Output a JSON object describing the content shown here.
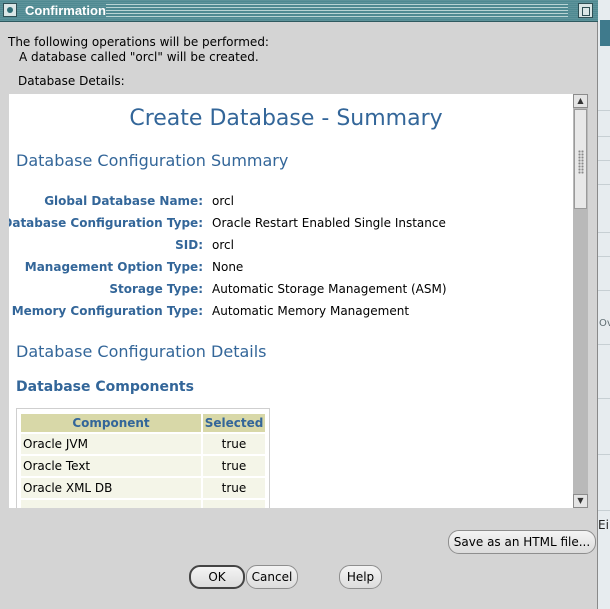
{
  "window": {
    "title": "Confirmation"
  },
  "intro": {
    "line1": "The following operations will be performed:",
    "line2": "A database called \"orcl\" will be created."
  },
  "details_label": "Database Details:",
  "summary": {
    "title": "Create Database - Summary",
    "config_summary_heading": "Database Configuration Summary",
    "fields": [
      {
        "label": "Global Database Name:",
        "value": "orcl"
      },
      {
        "label": "Database Configuration Type:",
        "value": "Oracle Restart Enabled Single Instance"
      },
      {
        "label": "SID:",
        "value": "orcl"
      },
      {
        "label": "Management Option Type:",
        "value": "None"
      },
      {
        "label": "Storage Type:",
        "value": "Automatic Storage Management (ASM)"
      },
      {
        "label": "Memory Configuration Type:",
        "value": "Automatic Memory Management"
      }
    ],
    "config_details_heading": "Database Configuration Details",
    "components_heading": "Database Components",
    "components_table": {
      "headers": [
        "Component",
        "Selected"
      ],
      "rows": [
        {
          "component": "Oracle JVM",
          "selected": "true"
        },
        {
          "component": "Oracle Text",
          "selected": "true"
        },
        {
          "component": "Oracle XML DB",
          "selected": "true"
        }
      ]
    }
  },
  "buttons": {
    "save_html": "Save as an HTML file...",
    "ok": "OK",
    "cancel": "Cancel",
    "help": "Help"
  },
  "background_fragments": {
    "right_text_1": "Ov",
    "right_text_2": "Ei"
  },
  "colors": {
    "titlebar": "#4f8a92",
    "heading_blue": "#336699",
    "table_header_bg": "#d8d8a8",
    "table_cell_bg": "#f4f5e8",
    "dialog_bg": "#d4d4d4"
  }
}
